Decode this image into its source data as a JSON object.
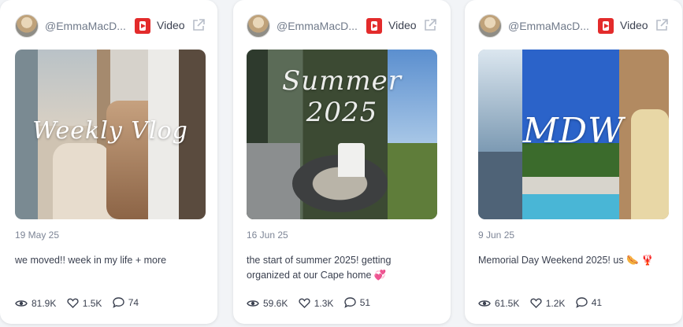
{
  "cards": [
    {
      "handle": "@EmmaMacD...",
      "type": "Video",
      "overlay": "Weekly Vlog",
      "date": "19 May 25",
      "caption": "we moved!! week in my life + more",
      "views": "81.9K",
      "likes": "1.5K",
      "comments": "74"
    },
    {
      "handle": "@EmmaMacD...",
      "type": "Video",
      "overlay": "Summer 2025",
      "date": "16 Jun 25",
      "caption": "the start of summer 2025! getting organized at our Cape home 💞",
      "views": "59.6K",
      "likes": "1.3K",
      "comments": "51"
    },
    {
      "handle": "@EmmaMacD...",
      "type": "Video",
      "overlay": "MDW",
      "date": "9 Jun 25",
      "caption": "Memorial Day Weekend 2025! us 🌭 🦞",
      "views": "61.5K",
      "likes": "1.2K",
      "comments": "41"
    }
  ],
  "colors": {
    "brand_video": "#e32b2b",
    "text": "#3b4150",
    "muted": "#7d8596"
  }
}
